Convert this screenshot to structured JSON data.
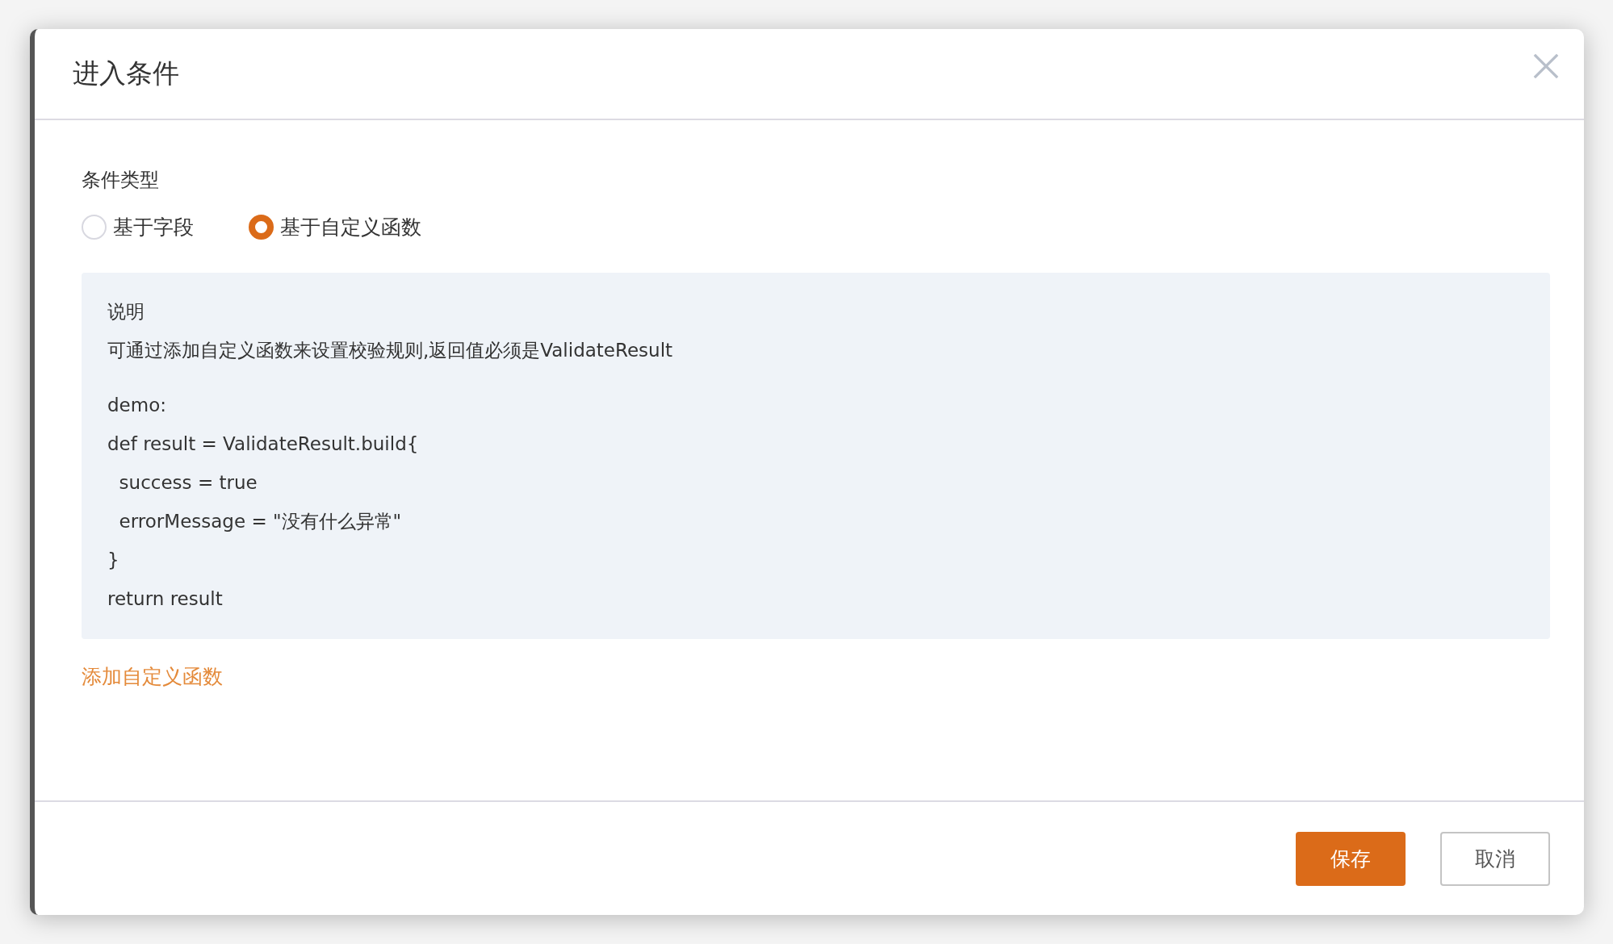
{
  "dialog": {
    "title": "进入条件"
  },
  "condition_type": {
    "label": "条件类型",
    "options": [
      {
        "label": "基于字段",
        "selected": false
      },
      {
        "label": "基于自定义函数",
        "selected": true
      }
    ]
  },
  "info": {
    "title": "说明",
    "description": "可通过添加自定义函数来设置校验规则,返回值必须是ValidateResult",
    "code_lines": [
      "demo:",
      "def result = ValidateResult.build{",
      "  success = true",
      "  errorMessage = \"没有什么异常\"",
      "}",
      "return result"
    ]
  },
  "add_link": "添加自定义函数",
  "buttons": [
    {
      "label": "保存",
      "kind": "primary"
    },
    {
      "label": "取消",
      "kind": "secondary"
    }
  ]
}
